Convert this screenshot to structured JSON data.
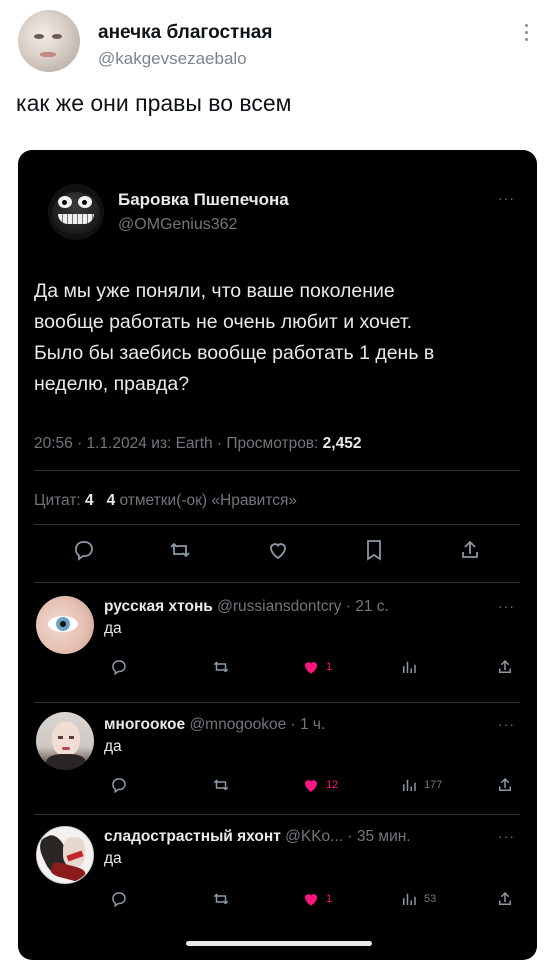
{
  "outer_post": {
    "author_name": "анечка благостная",
    "author_handle": "@kakgevsezaebalo",
    "text": "как же они правы во всем",
    "avatar_icon": "user-avatar-photo",
    "menu_icon": "more-vertical-icon"
  },
  "screenshot": {
    "quoted_tweet": {
      "author_name": "Баровка Пшепечона",
      "author_handle": "@OMGenius362",
      "text_lines": [
        "Да мы уже поняли, что ваше поколение",
        "вообще работать не очень любит и хочет.",
        "Было бы заебись вообще работать 1 день в",
        "неделю, правда?"
      ],
      "meta_prefix": "20:56 · 1.1.2024 из: Earth · Просмотров: ",
      "views": "2,452",
      "quotes_label": "Цитат: ",
      "quotes_count": "4",
      "likes_count": "4",
      "likes_label": " отметки(-ок) «Нравится»"
    },
    "replies": [
      {
        "name": "русская хтонь",
        "meta": " @russiansdontcry · 21 с.",
        "text": "да",
        "likes": "1",
        "views": ""
      },
      {
        "name": "многоокое",
        "meta": " @mnogookoe · 1 ч.",
        "text": "да",
        "likes": "12",
        "views": "177"
      },
      {
        "name": "сладострастный яхонт",
        "meta": " @KKo... · 35 мин.",
        "text": "да",
        "likes": "1",
        "views": "53"
      }
    ]
  },
  "colors": {
    "dark_bg": "#000000",
    "text_light": "#e7e9ea",
    "text_muted": "#71767b",
    "like_pink": "#f91880",
    "divider": "#2f3336"
  }
}
